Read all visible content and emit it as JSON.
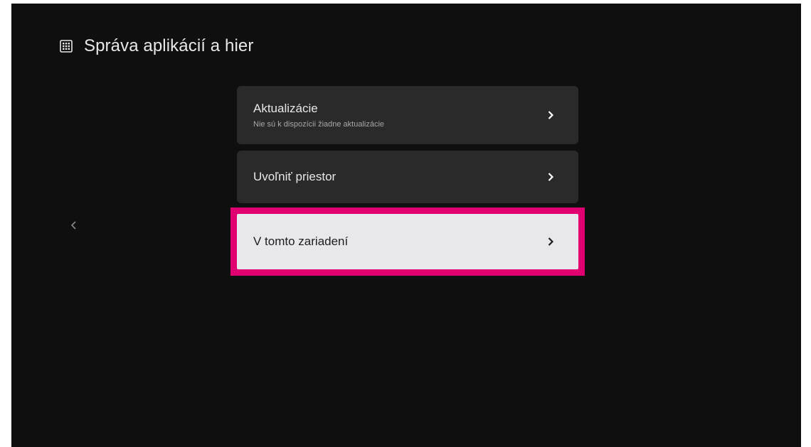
{
  "header": {
    "title": "Správa aplikácií a hier",
    "icon": "apps-grid-icon"
  },
  "menu": {
    "items": [
      {
        "title": "Aktualizácie",
        "subtitle": "Nie sú k dispozícii žiadne aktualizácie",
        "icon": "chevron-right-icon"
      },
      {
        "title": "Uvoľniť priestor",
        "icon": "chevron-right-icon"
      },
      {
        "title": "V tomto zariadení",
        "icon": "chevron-right-icon",
        "focused": true
      }
    ]
  },
  "colors": {
    "background": "#0f0f0f",
    "card": "#2a2a2a",
    "focused_card": "#e8e8ec",
    "highlight_border": "#e0006f",
    "text": "#e8e8e8"
  }
}
